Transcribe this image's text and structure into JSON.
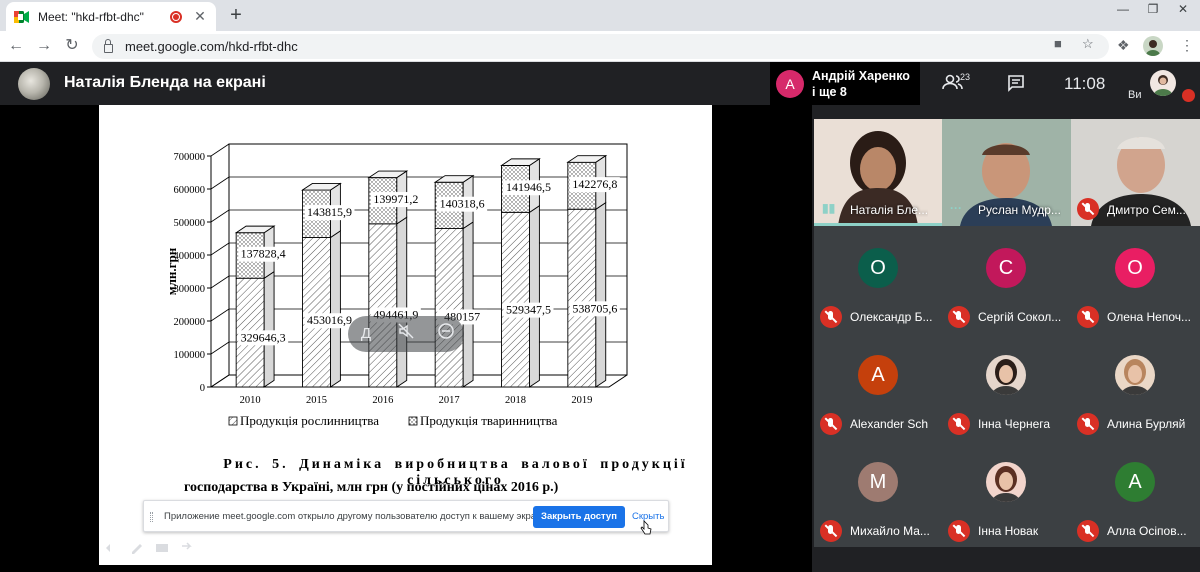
{
  "browser": {
    "tab_title": "Meet: \"hkd-rfbt-dhc\"",
    "tab_close": "✕",
    "new_tab": "+",
    "url": "meet.google.com/hkd-rfbt-dhc",
    "window_controls": [
      "—",
      "❐",
      "✕"
    ]
  },
  "header": {
    "presenting_title": "Наталія Бленда на екрані",
    "active_speaker_initial": "А",
    "active_speaker_line1": "Андрій Харенко",
    "active_speaker_line2": "і ще 8",
    "participants_count": "23",
    "time": "11:08",
    "me_label": "Ви"
  },
  "slide": {
    "caption_line1": "Рис.  5.  Динаміка  виробництва  валової  продукції  сільського",
    "caption_line2": "господарства в Україні, млн грн  (у постійних цінах 2016 р.)",
    "share_message": "Приложение meet.google.com открыло другому пользователю доступ к вашему экрану",
    "share_stop": "Закрыть доступ",
    "share_hide": "Скрыть",
    "overlay_pin_label": "Д",
    "colors": {
      "stop_button": "#1a73e8"
    }
  },
  "chart_data": {
    "type": "bar",
    "stacked": true,
    "categories": [
      "2010",
      "2015",
      "2016",
      "2017",
      "2018",
      "2019"
    ],
    "series": [
      {
        "name": "Продукція рослинництва",
        "values": [
          329646.3,
          453016.9,
          494461.9,
          480157,
          529347.5,
          538705.6
        ],
        "labels": [
          "329646,3",
          "453016,9",
          "494461,9",
          "480157",
          "529347,5",
          "538705,6"
        ]
      },
      {
        "name": "Продукція тваринництва",
        "values": [
          137828.4,
          143815.9,
          139971.2,
          140318.6,
          141946.5,
          142276.8
        ],
        "labels": [
          "137828,4",
          "143815,9",
          "139971,2",
          "140318,6",
          "141946,5",
          "142276,8"
        ]
      }
    ],
    "ylabel": "млн.грн",
    "ylim": [
      0,
      700000
    ],
    "yticks": [
      "0",
      "100000",
      "200000",
      "300000",
      "400000",
      "500000",
      "600000",
      "700000"
    ],
    "grid": true,
    "legend": "bottom"
  },
  "participants": {
    "video": [
      {
        "name": "Наталія Бле...",
        "speaking": true
      },
      {
        "name": "Руслан Мудр...",
        "speaking": false
      },
      {
        "name": "Дмитро Сем...",
        "muted": true
      }
    ],
    "tiles": [
      {
        "initial": "О",
        "name": "Олександр Б...",
        "color": "#0b5e4b"
      },
      {
        "initial": "С",
        "name": "Сергій Сокол...",
        "color": "#c2185b"
      },
      {
        "initial": "О",
        "name": "Олена Непоч...",
        "color": "#e91e63"
      },
      {
        "initial": "A",
        "name": "Alexander Sch",
        "color": "#c5400c"
      },
      {
        "initial": "",
        "name": "Інна Чернега",
        "color": "#e6d6cc"
      },
      {
        "initial": "",
        "name": "Алина Бурляй",
        "color": "#ead7c6"
      },
      {
        "initial": "М",
        "name": "Михайло Ма...",
        "color": "#9e7b71"
      },
      {
        "initial": "",
        "name": "Інна Новак",
        "color": "#f2d4cb"
      },
      {
        "initial": "А",
        "name": "Алла Осіпов...",
        "color": "#2e7d32"
      }
    ]
  }
}
